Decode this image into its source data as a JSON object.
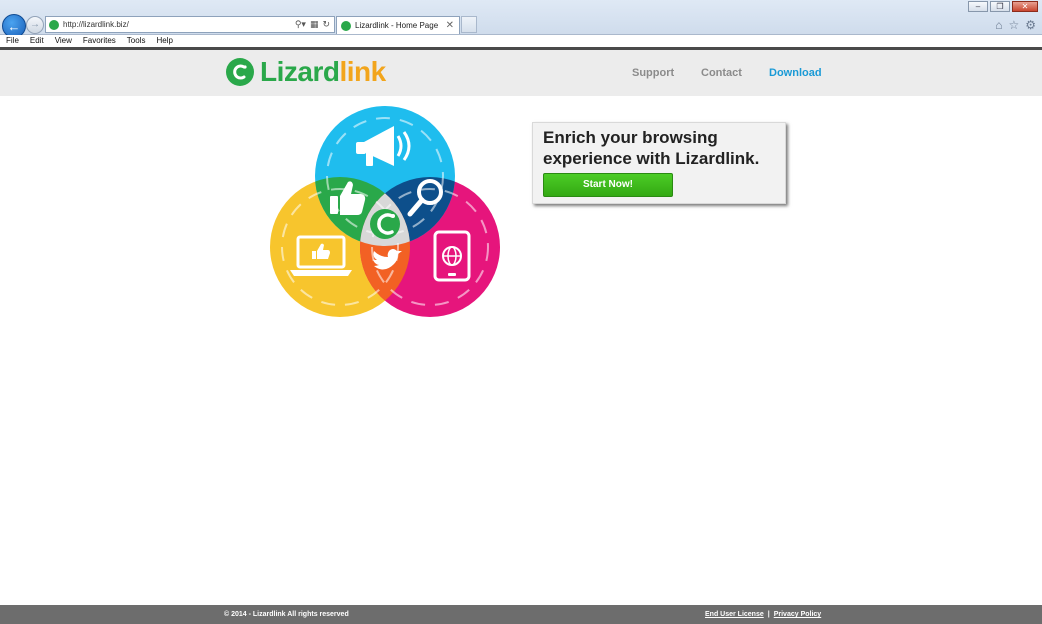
{
  "browser": {
    "address_url": "http://lizardlink.biz/",
    "tab_title": "Lizardlink - Home Page",
    "menu": [
      "File",
      "Edit",
      "View",
      "Favorites",
      "Tools",
      "Help"
    ]
  },
  "site": {
    "logo_part1": "Lizard",
    "logo_part2": "link",
    "nav": {
      "support": "Support",
      "contact": "Contact",
      "download": "Download"
    },
    "hero": {
      "heading": "Enrich your browsing experience with Lizardlink.",
      "cta_label": "Start Now!"
    },
    "footer": {
      "copyright": "© 2014 - Lizardlink All rights reserved",
      "eula": "End User License",
      "separator": "|",
      "privacy": "Privacy Policy"
    }
  },
  "colors": {
    "brand_green": "#2aa84a",
    "brand_orange": "#f2a51c",
    "link_blue": "#1a9ad6",
    "venn_cyan": "#1fbdee",
    "venn_yellow": "#f7c52d",
    "venn_magenta": "#e6157c",
    "cta_green": "#3cb81c"
  }
}
